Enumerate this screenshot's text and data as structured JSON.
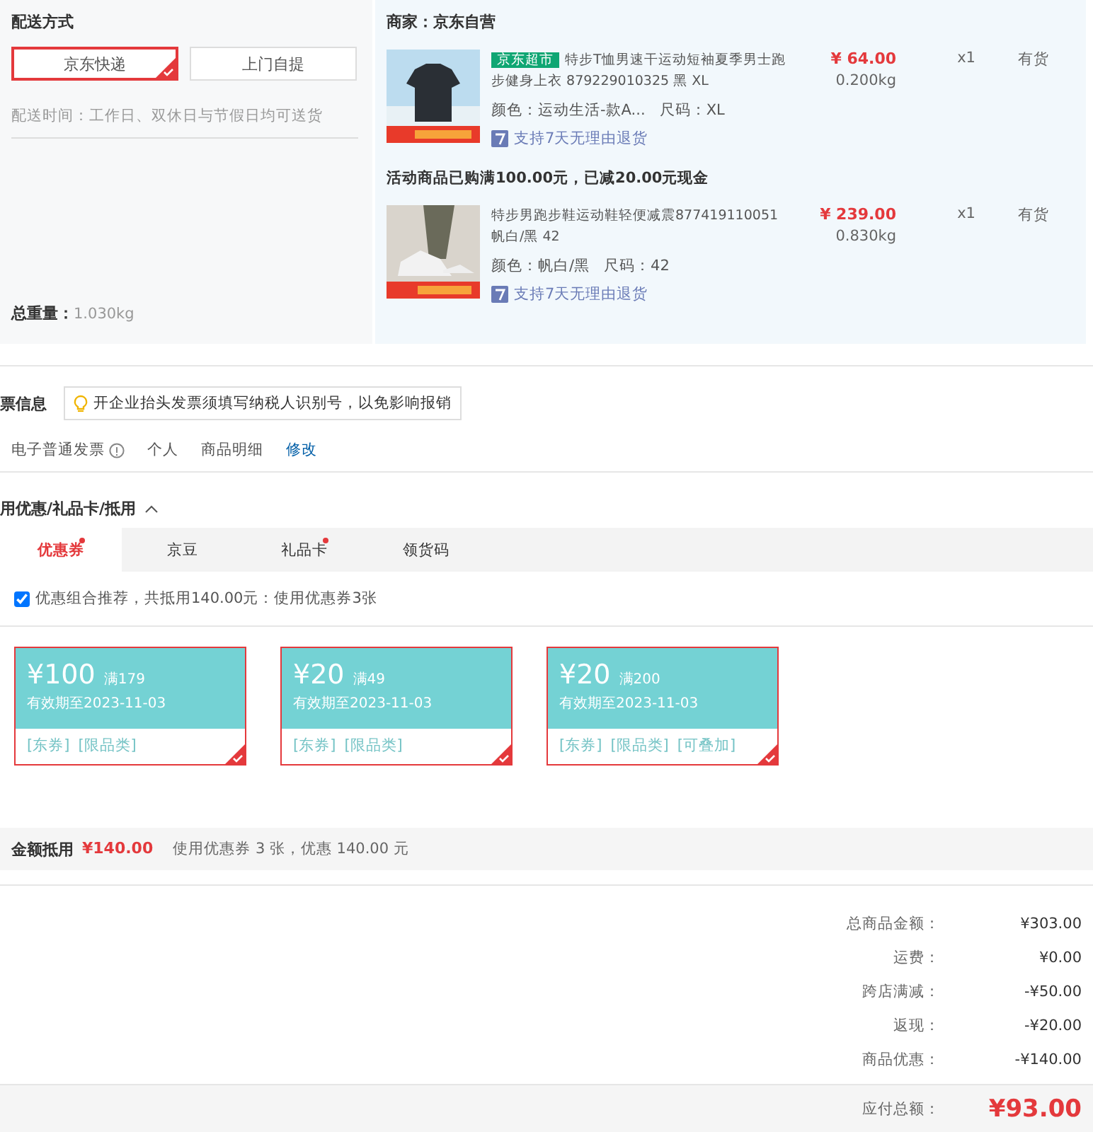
{
  "delivery": {
    "title": "配送方式",
    "options": [
      {
        "label": "京东快递",
        "selected": true
      },
      {
        "label": "上门自提",
        "selected": false
      }
    ],
    "time": "配送时间：工作日、双休日与节假日均可送货",
    "weight_label": "总重量：",
    "weight": "1.030kg"
  },
  "shop": {
    "merchant": "商家：京东自营",
    "groups": [
      {
        "items": [
          {
            "badge": "京东超市",
            "title": "特步T恤男速干运动短袖夏季男士跑步健身上衣 879229010325 黑 XL",
            "variant": "颜色：运动生活-款A...",
            "size": "尺码：XL",
            "price": "¥ 64.00",
            "weight": "0.200kg",
            "qty": "x1",
            "stock": "有货",
            "service": "支持7天无理由退货"
          }
        ]
      },
      {
        "promo": "活动商品已购满100.00元，已减20.00元现金",
        "items": [
          {
            "title": "特步男跑步鞋运动鞋轻便减震877419110051 帆白/黑 42",
            "variant": "颜色：帆白/黑",
            "size": "尺码：42",
            "price": "¥ 239.00",
            "weight": "0.830kg",
            "qty": "x1",
            "stock": "有货",
            "service": "支持7天无理由退货"
          }
        ]
      }
    ]
  },
  "invoice": {
    "title": "票信息",
    "tip": "开企业抬头发票须填写纳税人识别号，以免影响报销",
    "type": "电子普通发票",
    "holder": "个人",
    "content": "商品明细",
    "edit": "修改"
  },
  "discounts": {
    "title": "用优惠/礼品卡/抵用",
    "expanded": true,
    "tabs": [
      {
        "label": "优惠券",
        "selected": true,
        "dot": true
      },
      {
        "label": "京豆",
        "selected": false,
        "dot": false
      },
      {
        "label": "礼品卡",
        "selected": false,
        "dot": true
      },
      {
        "label": "领货码",
        "selected": false,
        "dot": false
      }
    ],
    "recommend": {
      "checked": true,
      "text": "优惠组合推荐，共抵用140.00元：使用优惠券3张"
    },
    "coupons": [
      {
        "amount": "¥100",
        "threshold": "满179",
        "expiry": "有效期至2023-11-03",
        "tags": [
          "[东券]",
          "[限品类]"
        ],
        "selected": true
      },
      {
        "amount": "¥20",
        "threshold": "满49",
        "expiry": "有效期至2023-11-03",
        "tags": [
          "[东券]",
          "[限品类]"
        ],
        "selected": true
      },
      {
        "amount": "¥20",
        "threshold": "满200",
        "expiry": "有效期至2023-11-03",
        "tags": [
          "[东券]",
          "[限品类]",
          "[可叠加]"
        ],
        "selected": true
      }
    ],
    "summary": {
      "label": "金额抵用",
      "amount": "¥140.00",
      "text": "使用优惠券 3 张，优惠 140.00 元"
    }
  },
  "totals": [
    {
      "label": "总商品金额：",
      "value": "¥303.00"
    },
    {
      "label": "运费：",
      "value": "¥0.00"
    },
    {
      "label": "跨店满减：",
      "value": "-¥50.00"
    },
    {
      "label": "返现：",
      "value": "-¥20.00"
    },
    {
      "label": "商品优惠：",
      "value": "-¥140.00"
    }
  ],
  "payable": {
    "label": "应付总额：",
    "value": "¥93.00"
  }
}
